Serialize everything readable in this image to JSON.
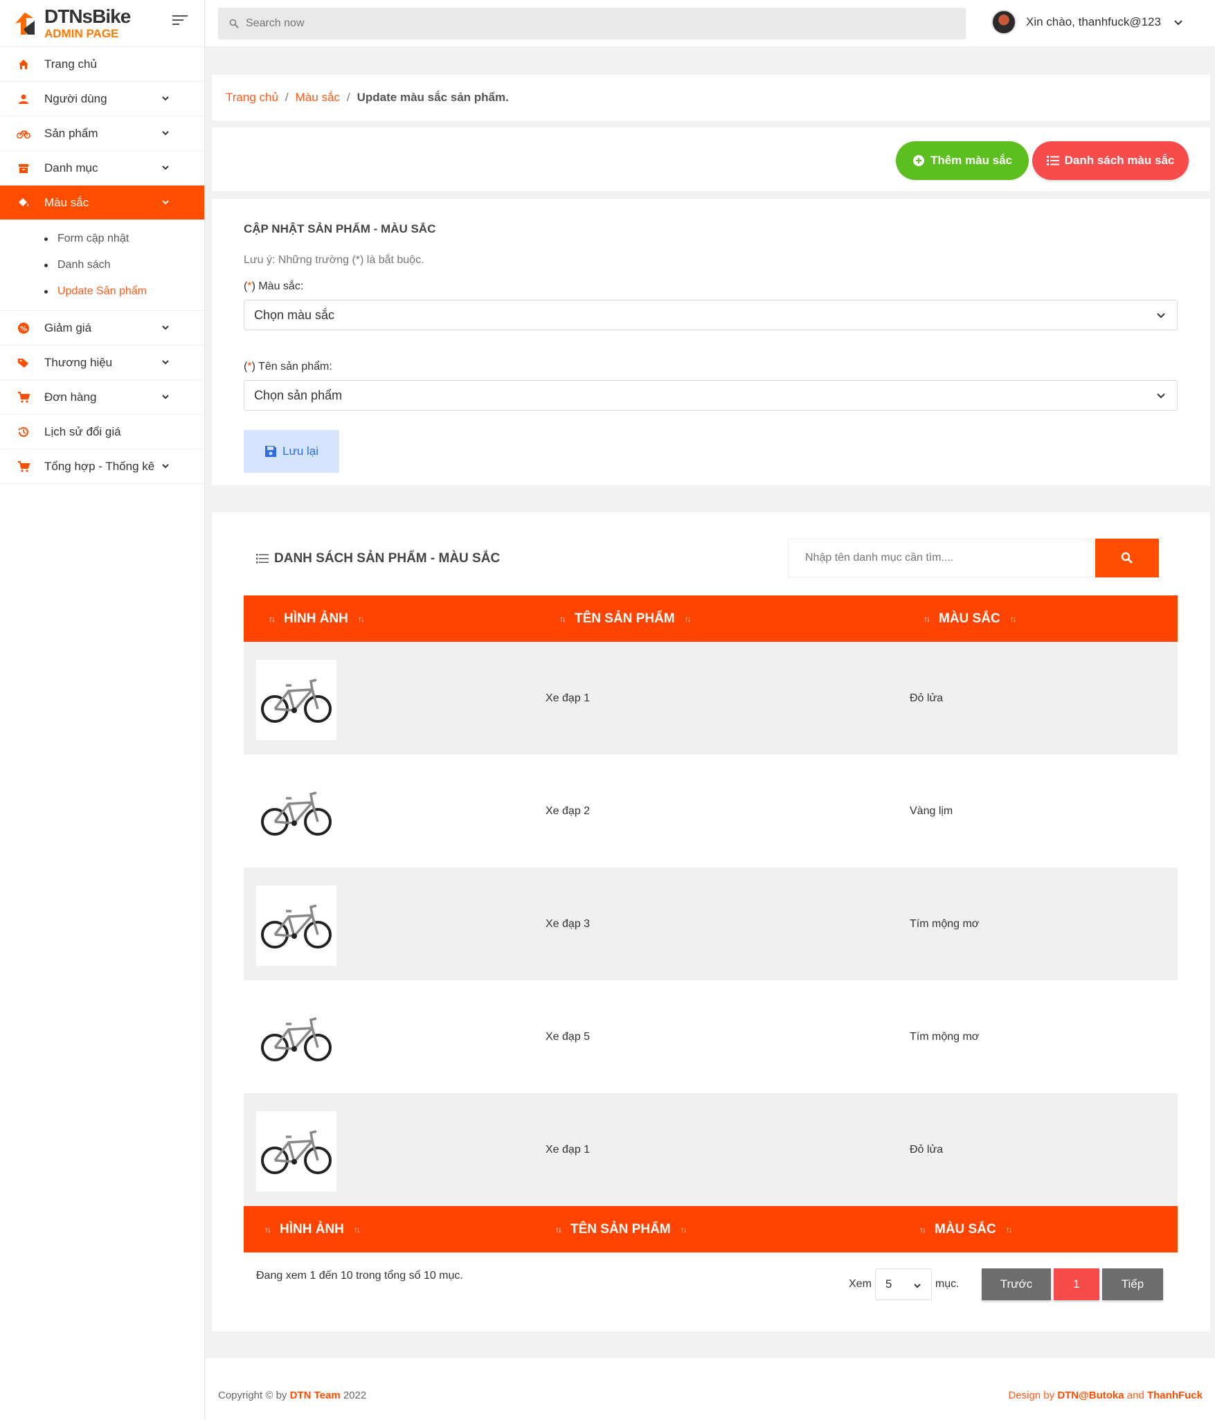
{
  "brand": {
    "name": "DTNsBike",
    "sub": "ADMIN PAGE"
  },
  "topbar": {
    "search_placeholder": "Search now",
    "greeting": "Xin chào, thanhfuck@123"
  },
  "sidebar": {
    "items": [
      {
        "label": "Trang chủ",
        "icon": "home-icon"
      },
      {
        "label": "Người dùng",
        "icon": "user-icon"
      },
      {
        "label": "Sản phẩm",
        "icon": "bicycle-icon"
      },
      {
        "label": "Danh mục",
        "icon": "archive-icon"
      },
      {
        "label": "Màu sắc",
        "icon": "paint-bucket-icon"
      },
      {
        "label": "Giảm giá",
        "icon": "discount-icon"
      },
      {
        "label": "Thương hiệu",
        "icon": "tag-icon"
      },
      {
        "label": "Đơn hàng",
        "icon": "cart-icon"
      },
      {
        "label": "Lịch sử đổi giá",
        "icon": "history-icon"
      },
      {
        "label": "Tổng hợp - Thống kê",
        "icon": "cart-icon"
      }
    ],
    "submenu": [
      "Form cập nhật",
      "Danh sách",
      "Update Sản phẩm"
    ]
  },
  "breadcrumb": {
    "home": "Trang chủ",
    "section": "Màu sắc",
    "current": "Update màu sắc sản phẩm."
  },
  "actions": {
    "add": "Thêm màu sắc",
    "list": "Danh sách màu sắc"
  },
  "form": {
    "title": "CẬP NHẬT SẢN PHẨM - MÀU SẮC",
    "note": "Lưu ý: Những trường (*) là bắt buộc.",
    "req": "*",
    "color_label": "Màu sắc:",
    "color_value": "Chọn màu sắc",
    "product_label": "Tên sản phẩm:",
    "product_value": "Chọn sản phẩm",
    "save": "Lưu lại"
  },
  "list": {
    "title": "DANH SÁCH SẢN PHẨM - MÀU SẮC",
    "search_placeholder": "Nhập tên danh mục cần tìm....",
    "headers": [
      "HÌNH ẢNH",
      "TÊN SẢN PHẨM",
      "MÀU SẮC"
    ],
    "rows": [
      {
        "name": "Xe đạp 1",
        "color": "Đỏ lửa"
      },
      {
        "name": "Xe đạp 2",
        "color": "Vàng lịm"
      },
      {
        "name": "Xe đạp 3",
        "color": "Tím mộng mơ"
      },
      {
        "name": "Xe đạp 5",
        "color": "Tím mộng mơ"
      },
      {
        "name": "Xe đạp 1",
        "color": "Đỏ lửa"
      }
    ],
    "info": "Đang xem 1 đến 10 trong tổng số 10 mục.",
    "show_label": "Xem",
    "show_value": "5",
    "show_suffix": "mục.",
    "prev": "Trước",
    "page": "1",
    "next": "Tiếp"
  },
  "footer": {
    "left_prefix": "Copyright © by ",
    "left_team": "DTN Team",
    "left_year": " 2022",
    "right_prefix": "Design by ",
    "right_a": "DTN@Butoka",
    "right_mid": " and ",
    "right_b": "ThanhFuck"
  },
  "colors": {
    "accent": "#ff4d00",
    "green": "#5cbf1f",
    "red": "#f74c4c"
  }
}
